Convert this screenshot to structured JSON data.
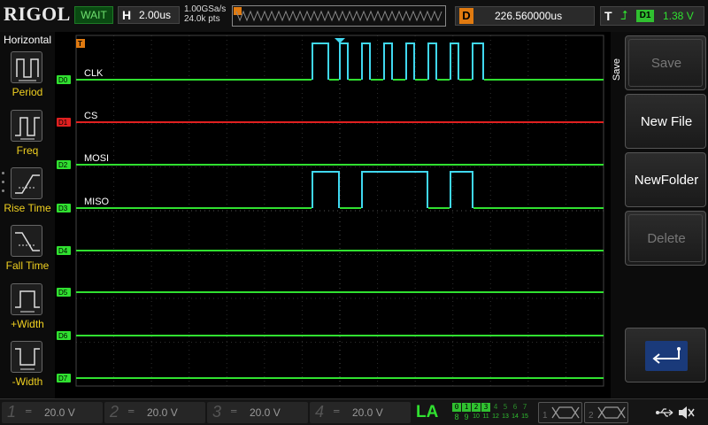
{
  "brand": "RIGOL",
  "status": "WAIT",
  "horizontal": {
    "label": "H",
    "timebase": "2.00us"
  },
  "acquisition": {
    "sample_rate": "1.00GSa/s",
    "memory_depth": "24.0k pts"
  },
  "delay": {
    "label": "D",
    "value": "226.560000us"
  },
  "trigger": {
    "label": "T",
    "edge_icon": "rising-edge-icon",
    "source": "D1",
    "level": "1.38 V"
  },
  "left_menu": {
    "title": "Horizontal",
    "items": [
      {
        "label": "Period",
        "icon": "period-measure-icon"
      },
      {
        "label": "Freq",
        "icon": "frequency-measure-icon"
      },
      {
        "label": "Rise Time",
        "icon": "rise-time-icon"
      },
      {
        "label": "Fall Time",
        "icon": "fall-time-icon"
      },
      {
        "label": "+Width",
        "icon": "positive-width-icon"
      },
      {
        "label": "-Width",
        "icon": "negative-width-icon"
      }
    ]
  },
  "right_menu": {
    "title": "Save",
    "buttons": [
      {
        "label": "Save",
        "enabled": false
      },
      {
        "label": "New File",
        "enabled": true
      },
      {
        "label": "NewFolder",
        "enabled": true
      },
      {
        "label": "Delete",
        "enabled": false
      }
    ],
    "return_icon": "return-arrow-icon"
  },
  "digital_channels": [
    {
      "id": "D0",
      "name": "CLK",
      "color": "#30e030"
    },
    {
      "id": "D1",
      "name": "CS",
      "color": "#e02020"
    },
    {
      "id": "D2",
      "name": "MOSI",
      "color": "#30e030"
    },
    {
      "id": "D3",
      "name": "MISO",
      "color": "#30e030"
    },
    {
      "id": "D4",
      "name": "",
      "color": "#30e030"
    },
    {
      "id": "D5",
      "name": "",
      "color": "#30e030"
    },
    {
      "id": "D6",
      "name": "",
      "color": "#30e030"
    },
    {
      "id": "D7",
      "name": "",
      "color": "#30e030"
    }
  ],
  "colors": {
    "high_level": "#40d8f0",
    "low_level": "#30e030",
    "trigger_marker": "#e07a10",
    "menu_label": "#f0d020"
  },
  "analog_channels": [
    {
      "num": "1",
      "coupling": "DC",
      "scale": "20.0 V"
    },
    {
      "num": "2",
      "coupling": "DC",
      "scale": "20.0 V"
    },
    {
      "num": "3",
      "coupling": "DC",
      "scale": "20.0 V"
    },
    {
      "num": "4",
      "coupling": "DC",
      "scale": "20.0 V"
    }
  ],
  "la": {
    "label": "LA",
    "row1": [
      "0",
      "1",
      "2",
      "3",
      "4",
      "5",
      "6",
      "7"
    ],
    "row2": [
      "8",
      "9",
      "10",
      "11",
      "12",
      "13",
      "14",
      "15"
    ],
    "row1_on": [
      true,
      true,
      true,
      true,
      false,
      false,
      false,
      false
    ]
  },
  "decoders": [
    {
      "num": "1",
      "icon": "decode-waveform-icon"
    },
    {
      "num": "2",
      "icon": "decode-waveform-icon"
    }
  ],
  "system_icons": [
    "usb-icon",
    "sound-muted-icon"
  ]
}
